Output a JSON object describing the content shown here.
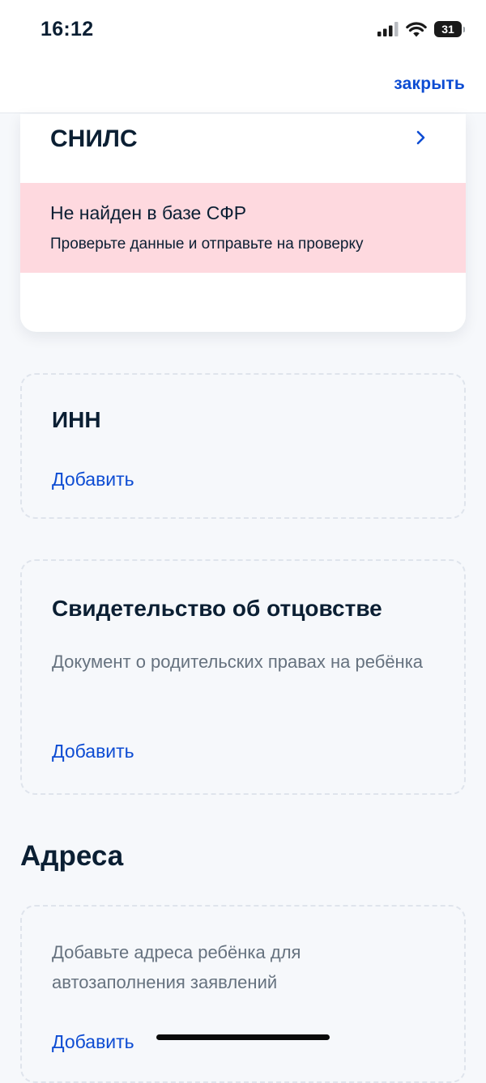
{
  "status_bar": {
    "time": "16:12",
    "battery_level": "31",
    "icons": [
      "cellular-signal-icon",
      "wifi-icon",
      "battery-icon"
    ]
  },
  "nav": {
    "close_label": "закрыть"
  },
  "snils": {
    "title": "СНИЛС",
    "error_title": "Не найден в базе СФР",
    "error_text": "Проверьте данные и отправьте на проверку",
    "chevron_icon": "chevron-right-icon"
  },
  "inn": {
    "title": "ИНН",
    "add_label": "Добавить"
  },
  "paternity": {
    "title": "Свидетельство об отцовстве",
    "description": "Документ о родительских правах на ребёнка",
    "add_label": "Добавить"
  },
  "addresses": {
    "section_title": "Адреса",
    "description": "Добавьте адреса ребёнка для автозаполнения заявлений",
    "add_label": "Добавить"
  },
  "colors": {
    "accent": "#0d4cd3",
    "error_background": "#fed9df",
    "page_background": "#f6f8fb",
    "text_primary": "#0b1f33",
    "text_secondary": "#66727f"
  }
}
